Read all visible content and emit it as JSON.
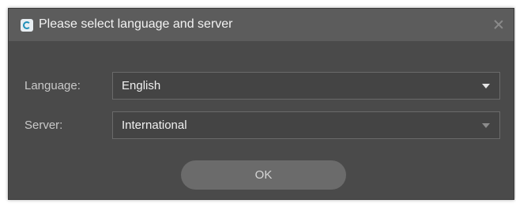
{
  "dialog": {
    "title": "Please select language and server",
    "app_icon": "app-logo-icon",
    "close_icon": "close-icon"
  },
  "form": {
    "language": {
      "label": "Language:",
      "value": "English"
    },
    "server": {
      "label": "Server:",
      "value": "International"
    }
  },
  "buttons": {
    "ok_label": "OK"
  }
}
